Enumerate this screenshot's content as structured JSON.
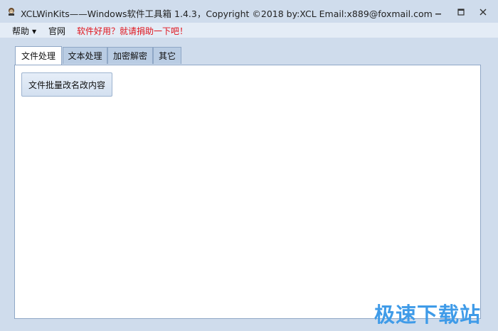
{
  "window": {
    "title": "XCLWinKits——Windows软件工具箱    1.4.3，Copyright ©2018 by:XCL Email:x889@foxmail.com",
    "controls": {
      "minimize_icon": "minimize-icon",
      "maximize_icon": "maximize-icon",
      "close_icon": "close-icon"
    }
  },
  "menu": {
    "help": "帮助",
    "site": "官网",
    "donate": "软件好用？就请捐助一下吧！"
  },
  "tabs": [
    {
      "label": "文件处理",
      "active": true
    },
    {
      "label": "文本处理",
      "active": false
    },
    {
      "label": "加密解密",
      "active": false
    },
    {
      "label": "其它",
      "active": false
    }
  ],
  "panel": {
    "batch_rename_button": "文件批量改名改内容"
  },
  "watermark": "极速下载站",
  "colors": {
    "accent_red": "#e0141c",
    "tab_inactive": "#b9cce3",
    "frame": "#cfdcec",
    "watermark": "#3f9be8"
  }
}
